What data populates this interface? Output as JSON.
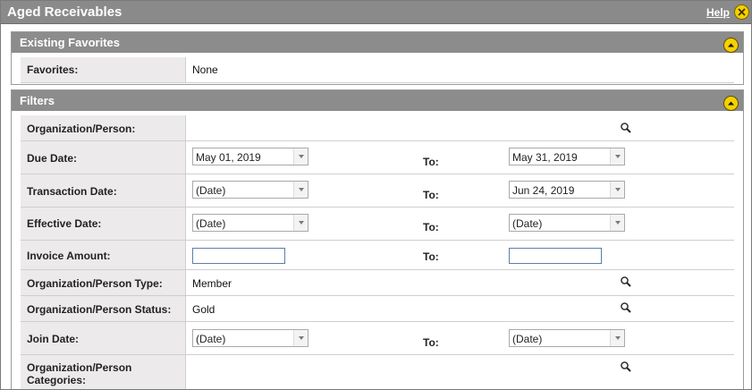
{
  "window": {
    "title": "Aged Receivables",
    "help_label": "Help"
  },
  "favorites": {
    "title": "Existing Favorites",
    "row_label": "Favorites:",
    "row_value": "None"
  },
  "filters": {
    "title": "Filters",
    "to_label": "To:",
    "org_person": {
      "label": "Organization/Person:"
    },
    "due_date": {
      "label": "Due Date:",
      "from": "May 01, 2019",
      "to": "May 31, 2019"
    },
    "transaction_date": {
      "label": "Transaction Date:",
      "from": "(Date)",
      "to": "Jun 24, 2019"
    },
    "effective_date": {
      "label": "Effective Date:",
      "from": "(Date)",
      "to": "(Date)"
    },
    "invoice_amount": {
      "label": "Invoice Amount:",
      "from": "",
      "to": ""
    },
    "org_person_type": {
      "label": "Organization/Person Type:",
      "value": "Member"
    },
    "org_person_status": {
      "label": "Organization/Person Status:",
      "value": "Gold"
    },
    "join_date": {
      "label": "Join Date:",
      "from": "(Date)",
      "to": "(Date)"
    },
    "org_person_categories": {
      "label_line1": "Organization/Person",
      "label_line2": "Categories:"
    }
  },
  "colors": {
    "title_bar": "#8a8a8a",
    "section_header": "#8c8c8c",
    "label_bg": "#edeaec",
    "accent_yellow": "#f5d100"
  },
  "icons": {
    "close": "close-icon",
    "collapse": "chevron-up-icon",
    "lookup": "magnifier-icon"
  }
}
